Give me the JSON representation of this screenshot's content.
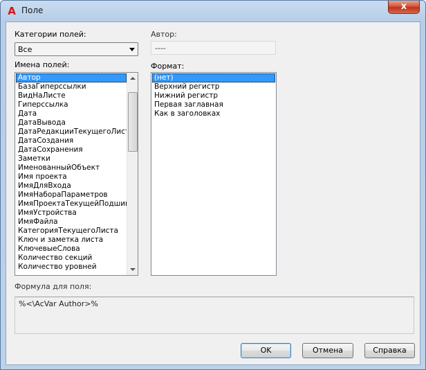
{
  "window": {
    "title": "Поле",
    "app_icon": "autocad-a-icon",
    "close_glyph": "x"
  },
  "categories": {
    "label": "Категории полей:",
    "selected": "Все"
  },
  "author": {
    "label": "Автор:",
    "value": "----"
  },
  "field_names": {
    "label": "Имена полей:",
    "items": [
      "Автор",
      "БазаГиперссылки",
      "ВидНаЛисте",
      "Гиперссылка",
      "Дата",
      "ДатаВывода",
      "ДатаРедакцииТекущегоЛиста",
      "ДатаСоздания",
      "ДатаСохранения",
      "Заметки",
      "ИменованныйОбъект",
      "Имя проекта",
      "ИмяДляВхода",
      "ИмяНабораПараметров",
      "ИмяПроектаТекущейПодшивки",
      "ИмяУстройства",
      "ИмяФайла",
      "КатегорияТекущегоЛиста",
      "Ключ и заметка листа",
      "КлючевыеСлова",
      "Количество секций",
      "Количество уровней"
    ],
    "selected_index": 0
  },
  "format": {
    "label": "Формат:",
    "items": [
      "(нет)",
      "Верхний регистр",
      "Нижний регистр",
      "Первая заглавная",
      "Как в заголовках"
    ],
    "selected_index": 0
  },
  "formula": {
    "label": "Формула для поля:",
    "value": "%<\\AcVar Author>%"
  },
  "buttons": {
    "ok": "OK",
    "cancel": "Отмена",
    "help": "Справка"
  }
}
